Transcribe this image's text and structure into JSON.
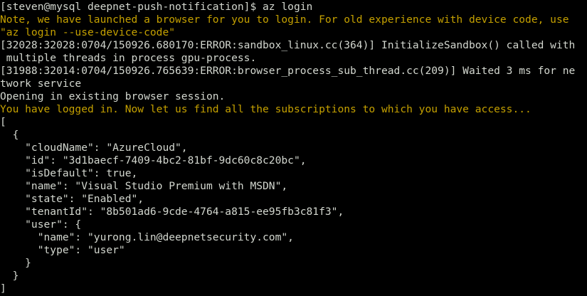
{
  "terminal": {
    "colors": {
      "background": "#000000",
      "text": "#d3d7cf",
      "warning": "#c4a000"
    },
    "prompt": "[steven@mysql deepnet-push-notification]$ az login",
    "lines": [
      {
        "style": "warn",
        "text": "Note, we have launched a browser for you to login. For old experience with device code, use"
      },
      {
        "style": "warn",
        "text": "\"az login --use-device-code\""
      },
      {
        "style": "normal",
        "text": "[32028:32028:0704/150926.680170:ERROR:sandbox_linux.cc(364)] InitializeSandbox() called with"
      },
      {
        "style": "normal",
        "text": " multiple threads in process gpu-process."
      },
      {
        "style": "normal",
        "text": "[31988:32014:0704/150926.765639:ERROR:browser_process_sub_thread.cc(209)] Waited 3 ms for ne"
      },
      {
        "style": "normal",
        "text": "twork service"
      },
      {
        "style": "normal",
        "text": "Opening in existing browser session."
      },
      {
        "style": "warn",
        "text": "You have logged in. Now let us find all the subscriptions to which you have access..."
      },
      {
        "style": "normal",
        "text": "["
      },
      {
        "style": "normal",
        "text": "  {"
      },
      {
        "style": "normal",
        "text": "    \"cloudName\": \"AzureCloud\","
      },
      {
        "style": "normal",
        "text": "    \"id\": \"3d1baecf-7409-4bc2-81bf-9dc60c8c20bc\","
      },
      {
        "style": "normal",
        "text": "    \"isDefault\": true,"
      },
      {
        "style": "normal",
        "text": "    \"name\": \"Visual Studio Premium with MSDN\","
      },
      {
        "style": "normal",
        "text": "    \"state\": \"Enabled\","
      },
      {
        "style": "normal",
        "text": "    \"tenantId\": \"8b501ad6-9cde-4764-a815-ee95fb3c81f3\","
      },
      {
        "style": "normal",
        "text": "    \"user\": {"
      },
      {
        "style": "normal",
        "text": "      \"name\": \"yurong.lin@deepnetsecurity.com\","
      },
      {
        "style": "normal",
        "text": "      \"type\": \"user\""
      },
      {
        "style": "normal",
        "text": "    }"
      },
      {
        "style": "normal",
        "text": "  }"
      },
      {
        "style": "normal",
        "text": "]"
      }
    ]
  }
}
